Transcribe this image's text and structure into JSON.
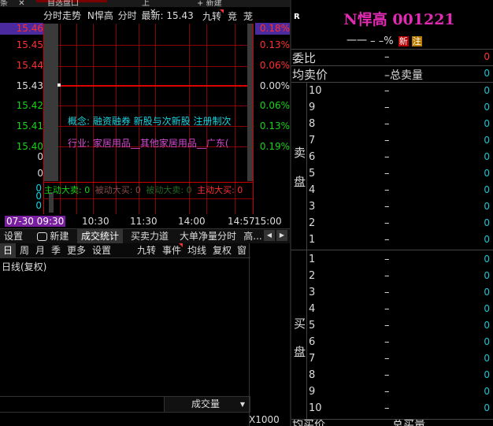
{
  "top_tabs": [
    "条",
    "自选盘口",
    "上",
    "新建"
  ],
  "chart_header": {
    "tab": "分时走势",
    "stock_name": "N悍高",
    "mode": "分时",
    "latest_label": "最新:",
    "latest_value": "15.43",
    "btn_jiuzhuan": "九转",
    "btn_jing": "竞",
    "btn_long": "茏"
  },
  "price_levels": [
    {
      "price": "15.46",
      "pct": "0.18%",
      "color": "#ff3030",
      "highlight": true
    },
    {
      "price": "15.45",
      "pct": "0.13%",
      "color": "#ff3030"
    },
    {
      "price": "15.44",
      "pct": "0.06%",
      "color": "#ff3030"
    },
    {
      "price": "15.43",
      "pct": "0.00%",
      "color": "#dddddd"
    },
    {
      "price": "15.42",
      "pct": "0.06%",
      "color": "#16d316"
    },
    {
      "price": "15.41",
      "pct": "0.13%",
      "color": "#16d316"
    },
    {
      "price": "15.40",
      "pct": "0.19%",
      "color": "#16d316"
    }
  ],
  "volume_axis": [
    "0",
    "0",
    "0",
    "0",
    "0"
  ],
  "overlay": {
    "concept": "概念: 融资融券  新股与次新股  注册制次",
    "industry": "行业: 家居用品__其他家居用品__广东("
  },
  "flow": {
    "active_sell": "主动大卖: 0",
    "passive_buy": "被动大买: 0",
    "passive_sell": "被动大卖: 0",
    "active_buy": "主动大买: 0"
  },
  "time_axis": {
    "start": "07-30 09:30",
    "t1": "10:30",
    "t2": "11:30",
    "t3": "14:00",
    "t4": "14:57",
    "t5": "15:00"
  },
  "tabs_row": {
    "settings": "设置",
    "new": "新建",
    "tab_chengjiao": "成交统计",
    "tab_maimai": "买卖力道",
    "tab_dadan": "大单净量分时",
    "tab_gao": "高..."
  },
  "kline_toolbar": {
    "day": "日",
    "week": "周",
    "month": "月",
    "season": "季",
    "more": "更多",
    "settings": "设置",
    "jiuzhuan": "九转",
    "event": "事件",
    "junxian": "均线",
    "fuquan": "复权",
    "window": "窗"
  },
  "kline_label": "日线(复权)",
  "volume_select": "成交量",
  "x1000": "X1000",
  "right_panel": {
    "r_badge": "R",
    "title": "N悍高 001221",
    "sub_dashes": "一一  –  –%",
    "badge_xin": "新",
    "badge_zhu": "注",
    "weibi_label": "委比",
    "weibi_value": "–",
    "weibi_num": "0",
    "junmai_label": "均卖价",
    "junmai_value": "–总卖量",
    "junmai_num": "0",
    "sell_label_1": "卖",
    "sell_label_2": "盘",
    "buy_label_1": "买",
    "buy_label_2": "盘",
    "sell_levels": [
      "10",
      "9",
      "8",
      "7",
      "6",
      "5",
      "4",
      "3",
      "2",
      "1"
    ],
    "buy_levels": [
      "1",
      "2",
      "3",
      "4",
      "5",
      "6",
      "7",
      "8",
      "9",
      "10"
    ],
    "dash": "–",
    "zero": "0",
    "bottom_label": "均买价",
    "bottom_value": "总买量"
  }
}
